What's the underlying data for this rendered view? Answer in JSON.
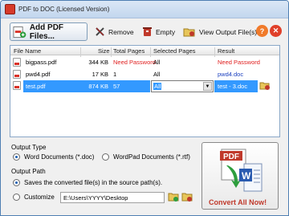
{
  "window": {
    "title": "PDF to DOC (Licensed Version)"
  },
  "toolbar": {
    "add_label": "Add PDF Files...",
    "remove_label": "Remove",
    "empty_label": "Empty",
    "view_label": "View Output File(s)"
  },
  "table": {
    "headers": [
      "File Name",
      "Size",
      "Total Pages",
      "Selected Pages",
      "Result"
    ],
    "rows": [
      {
        "name": "bigpass.pdf",
        "size": "344 KB",
        "pages": "Need Password",
        "selected": "All",
        "result": "Need Password"
      },
      {
        "name": "pwd4.pdf",
        "size": "17 KB",
        "pages": "1",
        "selected": "All",
        "result": "pwd4.doc"
      },
      {
        "name": "test.pdf",
        "size": "874 KB",
        "pages": "57",
        "selected": "All",
        "result": "test - 3.doc"
      }
    ]
  },
  "output_type": {
    "label": "Output Type",
    "options": [
      "Word Documents (*.doc)",
      "WordPad Documents (*.rtf)"
    ],
    "selected": "Word Documents (*.doc)"
  },
  "output_path": {
    "label": "Output Path",
    "source_option": "Saves the converted file(s) in the source path(s).",
    "custom_option": "Customize",
    "custom_value": "E:\\Users\\YYYY\\Desktop"
  },
  "convert": {
    "label": "Convert All Now!",
    "pdf_text": "PDF"
  },
  "colors": {
    "need_password": "#e02020",
    "link": "#1a3fbf",
    "selection": "#3399ff"
  }
}
